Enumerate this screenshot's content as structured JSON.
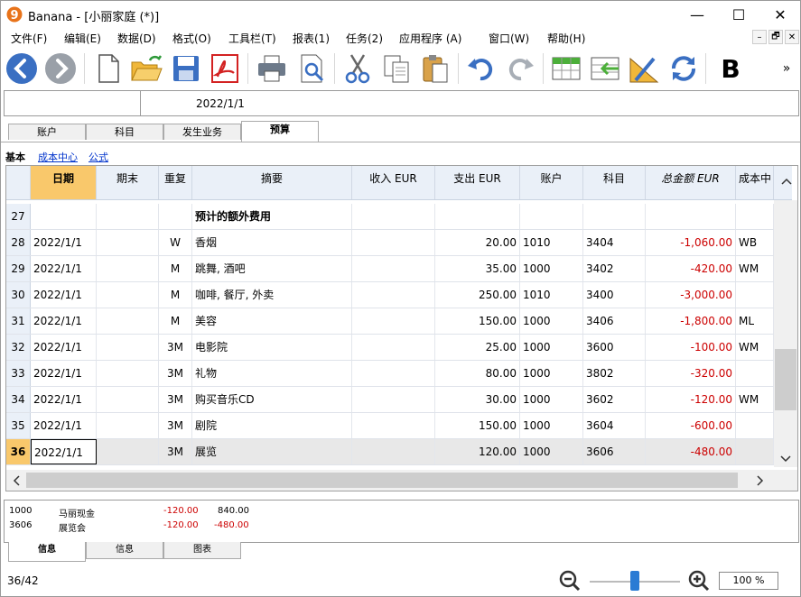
{
  "window": {
    "title": "Banana - [小丽家庭 (*)]",
    "app_logo_glyph": "9",
    "controls": {
      "minimize": "—",
      "maximize": "☐",
      "close": "✕"
    }
  },
  "menu": [
    "文件(F)",
    "编辑(E)",
    "数据(D)",
    "格式(O)",
    "工具栏(T)",
    "报表(1)",
    "任务(2)",
    "应用程序 (A)",
    "窗口(W)",
    "帮助(H)"
  ],
  "mdi_controls": [
    "–",
    "🗗",
    "✕"
  ],
  "toolbar": {
    "buttons": [
      "back-icon",
      "forward-icon",
      "new-file-icon",
      "open-folder-icon",
      "save-icon",
      "pdf-icon",
      "print-icon",
      "print-preview-icon",
      "cut-icon",
      "copy-icon",
      "paste-icon",
      "undo-icon",
      "redo-icon",
      "insert-row-icon",
      "move-row-icon",
      "edit-ruler-icon",
      "recheck-icon",
      "bold-icon"
    ],
    "bold_label": "B",
    "more": "»"
  },
  "cellbar": {
    "value": "2022/1/1"
  },
  "tabs": [
    "账户",
    "科目",
    "发生业务",
    "预算"
  ],
  "active_tab": "预算",
  "views": [
    "基本",
    "成本中心",
    "公式"
  ],
  "grid": {
    "columns": [
      "日期",
      "期末",
      "重复",
      "摘要",
      "收入 EUR",
      "支出 EUR",
      "账户",
      "科目",
      "总金额 EUR",
      "成本中"
    ],
    "rows": [
      {
        "n": "27",
        "date": "",
        "end": "",
        "rep": "",
        "desc": "预计的额外费用",
        "inc": "",
        "exp": "",
        "acc": "",
        "cat": "",
        "total": "",
        "cc": ""
      },
      {
        "n": "28",
        "date": "2022/1/1",
        "end": "",
        "rep": "W",
        "desc": "香烟",
        "inc": "",
        "exp": "20.00",
        "acc": "1010",
        "cat": "3404",
        "total": "-1,060.00",
        "cc": "WB"
      },
      {
        "n": "29",
        "date": "2022/1/1",
        "end": "",
        "rep": "M",
        "desc": "跳舞, 酒吧",
        "inc": "",
        "exp": "35.00",
        "acc": "1000",
        "cat": "3402",
        "total": "-420.00",
        "cc": "WM"
      },
      {
        "n": "30",
        "date": "2022/1/1",
        "end": "",
        "rep": "M",
        "desc": "咖啡, 餐厅, 外卖",
        "inc": "",
        "exp": "250.00",
        "acc": "1010",
        "cat": "3400",
        "total": "-3,000.00",
        "cc": ""
      },
      {
        "n": "31",
        "date": "2022/1/1",
        "end": "",
        "rep": "M",
        "desc": "美容",
        "inc": "",
        "exp": "150.00",
        "acc": "1000",
        "cat": "3406",
        "total": "-1,800.00",
        "cc": "ML"
      },
      {
        "n": "32",
        "date": "2022/1/1",
        "end": "",
        "rep": "3M",
        "desc": "电影院",
        "inc": "",
        "exp": "25.00",
        "acc": "1000",
        "cat": "3600",
        "total": "-100.00",
        "cc": "WM"
      },
      {
        "n": "33",
        "date": "2022/1/1",
        "end": "",
        "rep": "3M",
        "desc": "礼物",
        "inc": "",
        "exp": "80.00",
        "acc": "1000",
        "cat": "3802",
        "total": "-320.00",
        "cc": ""
      },
      {
        "n": "34",
        "date": "2022/1/1",
        "end": "",
        "rep": "3M",
        "desc": "购买音乐CD",
        "inc": "",
        "exp": "30.00",
        "acc": "1000",
        "cat": "3602",
        "total": "-120.00",
        "cc": "WM"
      },
      {
        "n": "35",
        "date": "2022/1/1",
        "end": "",
        "rep": "3M",
        "desc": "剧院",
        "inc": "",
        "exp": "150.00",
        "acc": "1000",
        "cat": "3604",
        "total": "-600.00",
        "cc": ""
      },
      {
        "n": "36",
        "date": "2022/1/1",
        "end": "",
        "rep": "3M",
        "desc": "展览",
        "inc": "",
        "exp": "120.00",
        "acc": "1000",
        "cat": "3606",
        "total": "-480.00",
        "cc": ""
      }
    ]
  },
  "info": [
    {
      "acc": "1000",
      "name": "马丽现金",
      "a": "-120.00",
      "b": "840.00"
    },
    {
      "acc": "3606",
      "name": "展览会",
      "a": "-120.00",
      "b": "-480.00"
    }
  ],
  "bottom_tabs": [
    "信息",
    "信息",
    "图表"
  ],
  "status": {
    "position": "36/42",
    "zoom": "100 %",
    "zoom_level": 0.5
  },
  "colors": {
    "selected_header": "#f9c86b",
    "negative": "#cc0000",
    "link": "#0033cc"
  }
}
